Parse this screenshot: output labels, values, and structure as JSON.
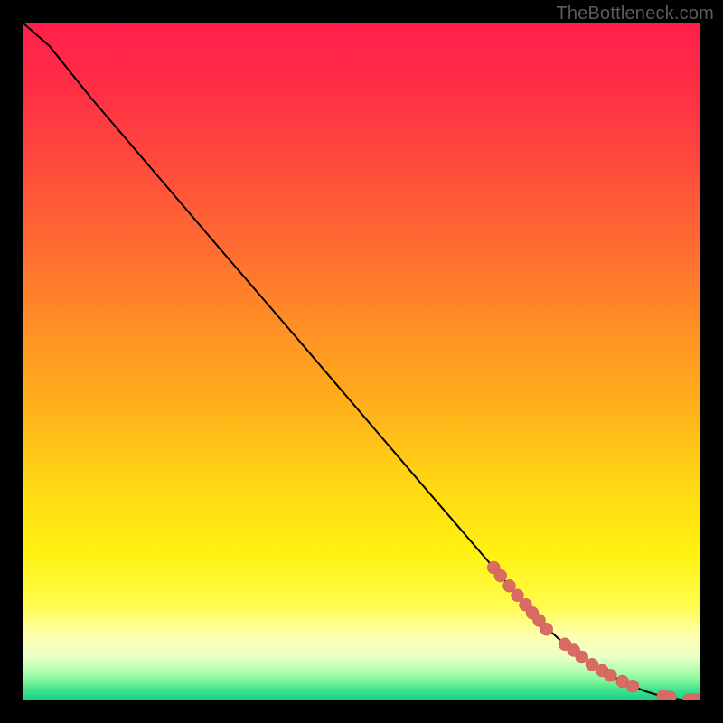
{
  "attribution": "TheBottleneck.com",
  "colors": {
    "curve": "#000000",
    "marker_fill": "#d96b63",
    "marker_stroke": "#ca5a53",
    "black_bg": "#000000"
  },
  "chart_data": {
    "type": "line",
    "title": "",
    "xlabel": "",
    "ylabel": "",
    "xlim": [
      0,
      100
    ],
    "ylim": [
      0,
      100
    ],
    "x": [
      0,
      4,
      10,
      20,
      30,
      40,
      50,
      60,
      70,
      76.5,
      80,
      83,
      86,
      88.5,
      90.5,
      92,
      93.3,
      95,
      97,
      98.5,
      100
    ],
    "y": [
      100,
      96.5,
      89,
      77.3,
      65.6,
      54,
      42.3,
      30.6,
      19,
      11.4,
      8.3,
      6,
      4.1,
      2.8,
      1.9,
      1.3,
      0.9,
      0.45,
      0.15,
      0.05,
      0.02
    ],
    "markers": {
      "x": [
        69.5,
        70.5,
        71.8,
        73.0,
        74.2,
        75.2,
        76.2,
        77.3,
        80.0,
        81.3,
        82.5,
        84.0,
        85.5,
        86.7,
        88.5,
        90.0,
        94.5,
        95.5,
        98.3,
        99.3
      ],
      "y": [
        19.6,
        18.4,
        16.9,
        15.5,
        14.1,
        12.9,
        11.8,
        10.5,
        8.3,
        7.4,
        6.4,
        5.3,
        4.4,
        3.7,
        2.8,
        2.1,
        0.6,
        0.45,
        0.07,
        0.05
      ],
      "r": 7
    },
    "gradient_stops": [
      {
        "offset": 0.0,
        "color": "#ff1f4b"
      },
      {
        "offset": 0.1,
        "color": "#ff2f45"
      },
      {
        "offset": 0.22,
        "color": "#ff4d3b"
      },
      {
        "offset": 0.34,
        "color": "#ff6e30"
      },
      {
        "offset": 0.46,
        "color": "#ff9224"
      },
      {
        "offset": 0.58,
        "color": "#ffb41a"
      },
      {
        "offset": 0.68,
        "color": "#ffd714"
      },
      {
        "offset": 0.78,
        "color": "#fff110"
      },
      {
        "offset": 0.86,
        "color": "#fffc4d"
      },
      {
        "offset": 0.905,
        "color": "#ffffb0"
      },
      {
        "offset": 0.935,
        "color": "#ecffc8"
      },
      {
        "offset": 0.955,
        "color": "#b7ffb0"
      },
      {
        "offset": 0.972,
        "color": "#7df59a"
      },
      {
        "offset": 0.985,
        "color": "#3fe28d"
      },
      {
        "offset": 1.0,
        "color": "#16cf86"
      }
    ]
  }
}
